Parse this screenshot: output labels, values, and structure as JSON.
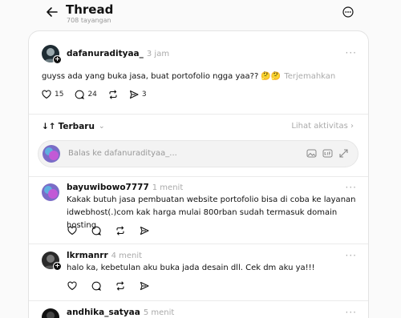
{
  "header": {
    "title": "Thread",
    "views": "708 tayangan"
  },
  "post": {
    "username": "dafanuradityaa_",
    "time": "3 jam",
    "text": "guyss ada yang buka jasa, buat portofolio ngga yaa?? 🤔🤔",
    "translate": "Terjemahkan",
    "likes": "15",
    "comments": "24",
    "shares": "3"
  },
  "sort": {
    "label": "Terbaru",
    "activity": "Lihat aktivitas"
  },
  "reply": {
    "placeholder": "Balas ke dafanuradityaa_..."
  },
  "replies": [
    {
      "username": "bayuwibowo7777",
      "time": "1 menit",
      "line1": "Kakak butuh jasa pembuatan website portofolio bisa di coba ke layanan",
      "line2": "idwebhost(.)com kak harga mulai 800rban sudah termasuk domain hosting"
    },
    {
      "username": "lkrmanrr",
      "time": "4 menit",
      "line1": "halo ka, kebetulan aku buka jada desain dll. Cek dm aku ya!!!"
    },
    {
      "username": "andhika_satyaa",
      "time": "5 menit"
    }
  ]
}
